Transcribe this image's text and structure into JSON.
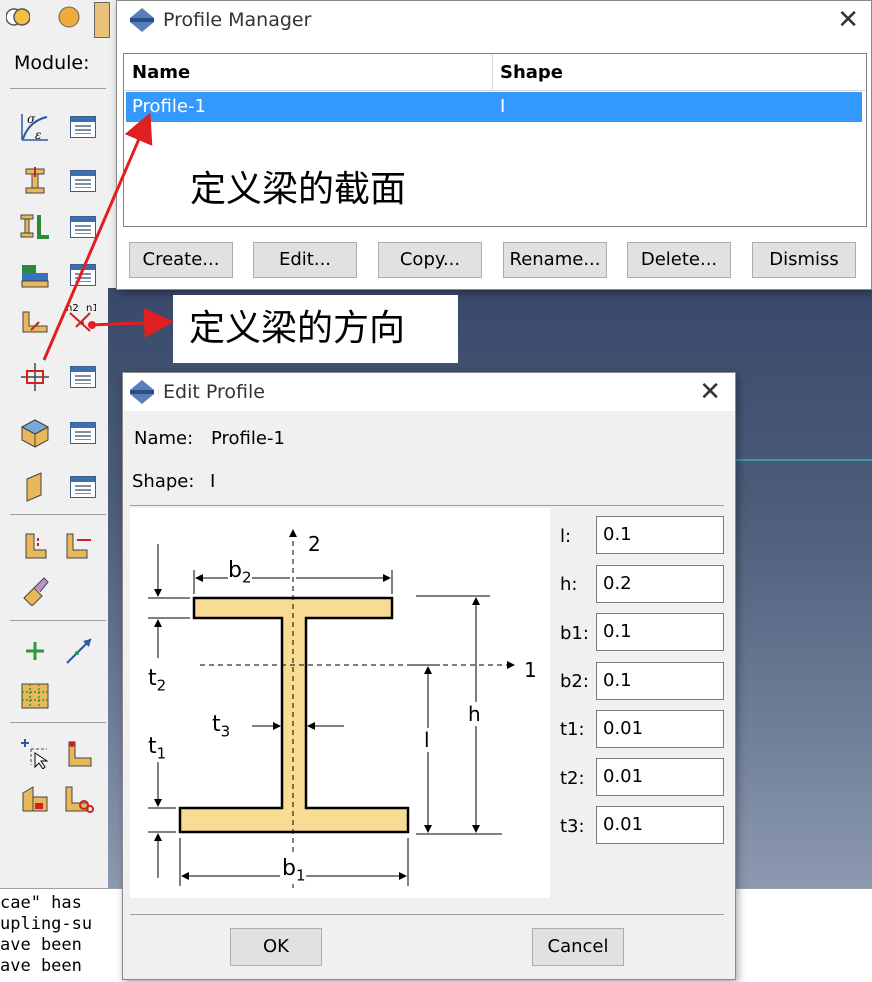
{
  "toolbar": {
    "module_label": "Module:"
  },
  "profile_manager": {
    "title": "Profile Manager",
    "columns": [
      "Name",
      "Shape"
    ],
    "rows": [
      {
        "name": "Profile-1",
        "shape": "I"
      }
    ],
    "buttons": {
      "create": "Create...",
      "edit": "Edit...",
      "copy": "Copy...",
      "rename": "Rename...",
      "delete": "Delete...",
      "dismiss": "Dismiss"
    }
  },
  "annotations": {
    "section_label": "定义梁的截面",
    "orientation_label": "定义梁的方向"
  },
  "edit_profile": {
    "title": "Edit Profile",
    "name_label": "Name:",
    "name_value": "Profile-1",
    "shape_label": "Shape:",
    "shape_value": "I",
    "params": [
      {
        "label": "l:",
        "value": "0.1"
      },
      {
        "label": "h:",
        "value": "0.2"
      },
      {
        "label": "b1:",
        "value": "0.1"
      },
      {
        "label": "b2:",
        "value": "0.1"
      },
      {
        "label": "t1:",
        "value": "0.01"
      },
      {
        "label": "t2:",
        "value": "0.01"
      },
      {
        "label": "t3:",
        "value": "0.01"
      }
    ],
    "diagram_labels": {
      "axis2": "2",
      "axis1": "1",
      "b2": "b",
      "b2_sub": "2",
      "b1": "b",
      "b1_sub": "1",
      "t2": "t",
      "t2_sub": "2",
      "t1": "t",
      "t1_sub": "1",
      "t3": "t",
      "t3_sub": "3",
      "h": "h",
      "l": "l"
    },
    "ok": "OK",
    "cancel": "Cancel"
  },
  "message_area": {
    "lines": [
      "cae\" has",
      "upling-su",
      "ave been",
      "ave been"
    ]
  },
  "colors": {
    "selection": "#3399ff",
    "arrow": "#e02020",
    "section_fill": "#f8dc94"
  }
}
